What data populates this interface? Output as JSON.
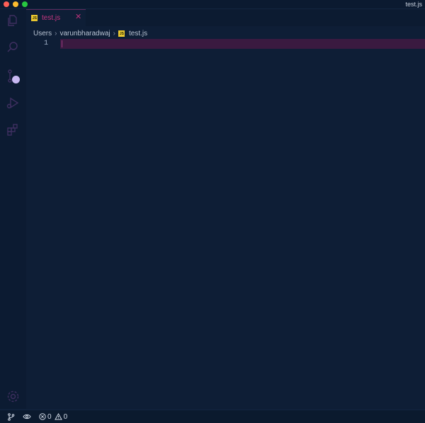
{
  "window": {
    "title": "test.js"
  },
  "activity_bar": {
    "items": [
      {
        "icon": "explorer-icon"
      },
      {
        "icon": "search-icon"
      },
      {
        "icon": "source-control-icon"
      },
      {
        "icon": "run-debug-icon"
      },
      {
        "icon": "extensions-icon"
      }
    ],
    "manage_icon": "gear-icon"
  },
  "tabs": [
    {
      "label": "test.js",
      "icon_text": "JS",
      "active": true
    }
  ],
  "breadcrumb": {
    "items": [
      "Users",
      "varunbharadwaj",
      "test.js"
    ],
    "file_icon_text": "JS"
  },
  "editor": {
    "line_numbers": [
      "1"
    ],
    "current_line_color": "#3a1a40"
  },
  "status_bar": {
    "errors": "0",
    "warnings": "0"
  },
  "colors": {
    "background": "#0e1e36",
    "tab_active_text": "#c4367f",
    "js_badge": "#e8c731",
    "activity_icon": "#3c2c5c",
    "timer_badge": "#c8b8f2"
  }
}
